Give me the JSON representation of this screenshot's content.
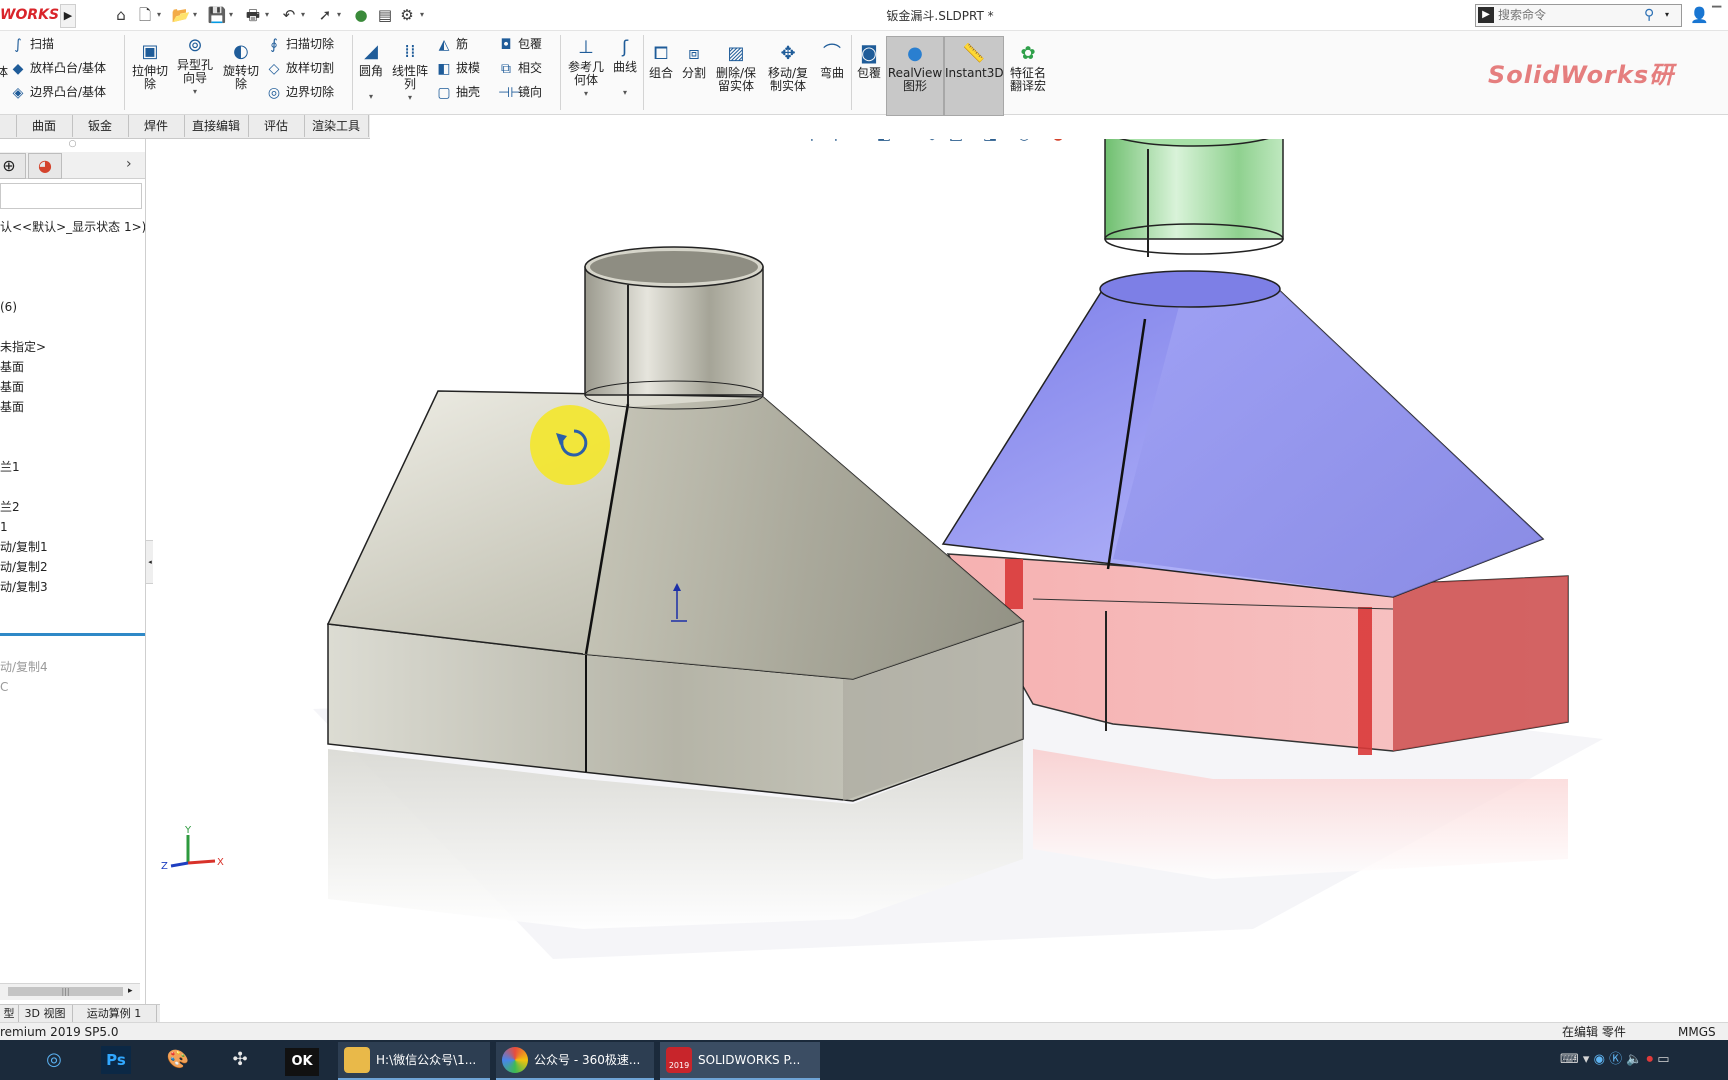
{
  "app": {
    "logo_text": "WORKS",
    "document_title": "钣金漏斗.SLDPRT *",
    "brand_watermark": "SolidWorks研"
  },
  "search": {
    "placeholder": "搜索命令"
  },
  "quick_access": {
    "icons": [
      "home-icon",
      "new-document-icon",
      "open-folder-icon",
      "save-icon",
      "print-icon",
      "undo-icon",
      "select-arrow-icon",
      "traffic-light-icon",
      "file-properties-icon",
      "options-gear-icon"
    ]
  },
  "ribbon": {
    "left_stack": [
      "扫描",
      "放样凸台/基体",
      "边界凸台/基体"
    ],
    "left_cut_label": "体",
    "cut_extrude": "拉伸切\n除",
    "hole_wizard": "异型孔\n向导",
    "revolve_cut": "旋转切\n除",
    "cut_stack": [
      "扫描切除",
      "放样切割",
      "边界切除"
    ],
    "fillet": "圆角",
    "linear_pattern": "线性阵\n列",
    "rib_stack": [
      "筋",
      "拔模",
      "抽壳"
    ],
    "wrap_stack": [
      "包覆",
      "相交",
      "镜向"
    ],
    "ref_geometry": "参考几\n何体",
    "curves": "曲线",
    "combine": "组合",
    "split": "分割",
    "delete_keep_body": "删除/保\n留实体",
    "move_copy_body": "移动/复\n制实体",
    "flex": "弯曲",
    "wrap": "包覆",
    "realview": "RealView\n图形",
    "instant3d": "Instant3D",
    "feature_translation": "特征名\n翻译宏"
  },
  "tabs": [
    "曲面",
    "钣金",
    "焊件",
    "直接编辑",
    "评估",
    "渲染工具"
  ],
  "feature_tree": {
    "display_state": "认<<默认>_显示状态 1>)",
    "items": [
      {
        "label": "(6)",
        "grey": false
      },
      {
        "label": "未指定>",
        "grey": false
      },
      {
        "label": "基面",
        "grey": false
      },
      {
        "label": "基面",
        "grey": false
      },
      {
        "label": "基面",
        "grey": false
      },
      {
        "label": "兰1",
        "grey": false
      },
      {
        "label": "兰2",
        "grey": false
      },
      {
        "label": "1",
        "grey": false
      },
      {
        "label": "动/复制1",
        "grey": false
      },
      {
        "label": "动/复制2",
        "grey": false
      },
      {
        "label": "动/复制3",
        "grey": false
      },
      {
        "label": "动/复制4",
        "grey": true
      }
    ]
  },
  "bottom_tabs": [
    "型",
    "3D 视图",
    "运动算例 1"
  ],
  "status": {
    "version": "remium 2019 SP5.0",
    "editing": "在编辑 零件",
    "units": "MMGS"
  },
  "taskbar": {
    "windows": [
      {
        "label": "H:\\微信公众号\\1...",
        "color": "#e9b949"
      },
      {
        "label": "公众号 - 360极速...",
        "color": "#4aa3df"
      },
      {
        "label": "SOLIDWORKS P...",
        "color": "#c8252b"
      }
    ],
    "app_icons": [
      "chrome-like-icon",
      "photoshop-icon",
      "paint-icon",
      "fan-icon",
      "ok-app-icon"
    ],
    "photoshop_label": "Ps",
    "ok_label": "OK",
    "sw_badge": "2019"
  },
  "triad": {
    "x": "X",
    "y": "Y",
    "z": "Z"
  },
  "colors": {
    "accent_blue": "#2f89c7",
    "brand_red": "#e57e7e",
    "steel": "#b9b8ac",
    "blue_body": "#8f8ff0",
    "red_body": "#f4a0a0",
    "green_ring": "#8ed58e"
  }
}
